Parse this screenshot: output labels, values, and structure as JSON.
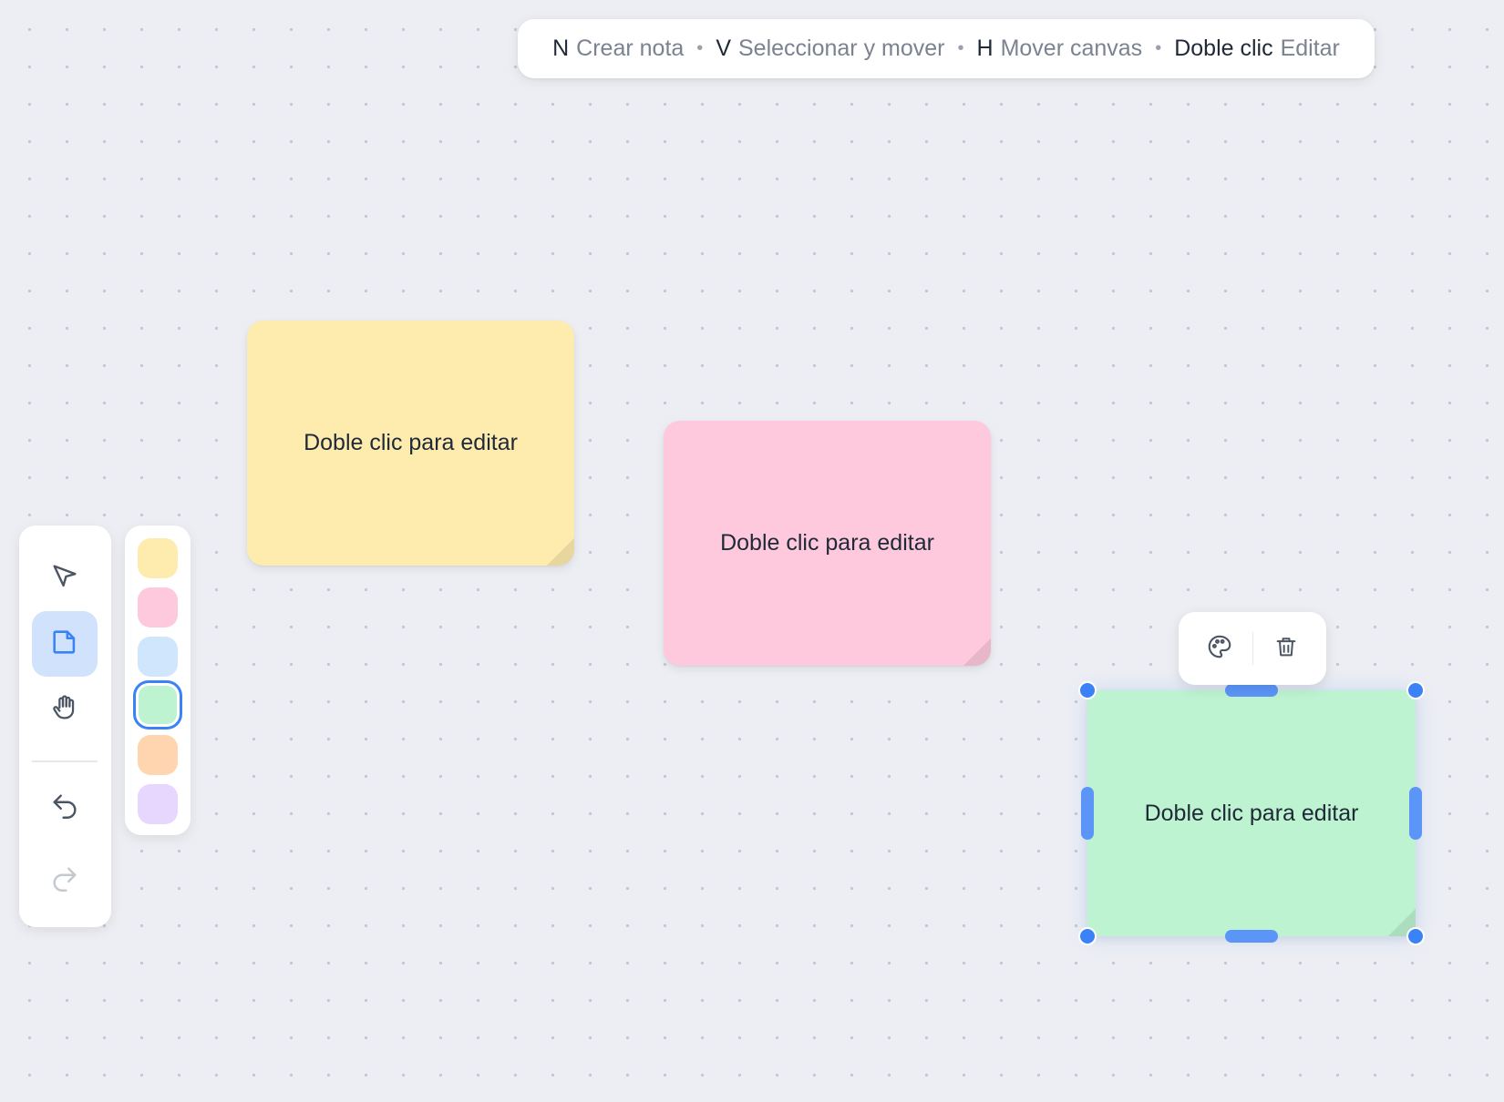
{
  "hints": [
    {
      "key": "N",
      "desc": "Crear nota"
    },
    {
      "key": "V",
      "desc": "Seleccionar y mover"
    },
    {
      "key": "H",
      "desc": "Mover canvas"
    },
    {
      "key": "Doble clic",
      "desc": "Editar"
    }
  ],
  "hint_separator": "•",
  "notes": [
    {
      "text": "Doble clic para editar",
      "color": "#feecaf"
    },
    {
      "text": "Doble clic para editar",
      "color": "#fec9dd"
    },
    {
      "text": "Doble clic para editar",
      "color": "#bdf3d1",
      "selected": true
    }
  ],
  "note_toolbar": {
    "icons": [
      "palette-icon",
      "trash-icon"
    ]
  },
  "toolbar": {
    "tools": [
      "select-icon",
      "sticky-note-icon",
      "hand-icon"
    ],
    "active_tool": "sticky-note-icon",
    "actions": [
      "undo-icon",
      "redo-icon"
    ]
  },
  "palette": {
    "colors": [
      "#feecaf",
      "#fec9dd",
      "#cfe6fd",
      "#bdf3d1",
      "#fed5ae",
      "#e7d6fd"
    ],
    "selected": "#bdf3d1"
  },
  "accent": "#3b82f6"
}
